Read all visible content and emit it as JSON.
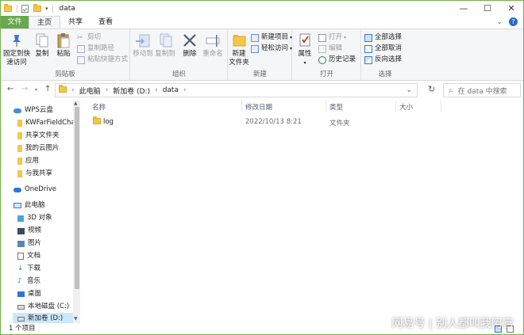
{
  "window": {
    "title": "data"
  },
  "controls": {
    "minimize": "—",
    "maximize": "☐",
    "close": "✕"
  },
  "tabs": [
    {
      "label": "文件"
    },
    {
      "label": "主页"
    },
    {
      "label": "共享"
    },
    {
      "label": "查看"
    }
  ],
  "ribbon": {
    "clipboard": {
      "pin": "固定到快\n速访问",
      "copy": "复制",
      "paste": "粘贴",
      "cut": "剪切",
      "copy_path": "复制路径",
      "paste_shortcut": "粘贴快捷方式",
      "label": "剪贴板"
    },
    "organize": {
      "move_to": "移动到",
      "copy_to": "复制到",
      "delete": "删除",
      "rename": "重命名",
      "label": "组织"
    },
    "new": {
      "new_folder": "新建\n文件夹",
      "new_item": "新建项目",
      "easy_access": "轻松访问",
      "label": "新建"
    },
    "open": {
      "properties": "属性",
      "open": "打开",
      "edit": "编辑",
      "history": "历史记录",
      "label": "打开"
    },
    "select": {
      "select_all": "全部选择",
      "select_none": "全部取消",
      "invert": "反向选择",
      "label": "选择"
    }
  },
  "address": {
    "crumbs": [
      "此电脑",
      "新加卷 (D:)",
      "data"
    ],
    "search_placeholder": "在 data 中搜索"
  },
  "nav": {
    "items": [
      {
        "label": "WPS云盘"
      },
      {
        "label": "KWFarFieldCha"
      },
      {
        "label": "共享文件夹"
      },
      {
        "label": "我的云图片"
      },
      {
        "label": "应用"
      },
      {
        "label": "与我共享"
      },
      {
        "label": "OneDrive"
      },
      {
        "label": "此电脑"
      },
      {
        "label": "3D 对象"
      },
      {
        "label": "视频"
      },
      {
        "label": "图片"
      },
      {
        "label": "文档"
      },
      {
        "label": "下载"
      },
      {
        "label": "音乐"
      },
      {
        "label": "桌面"
      },
      {
        "label": "本地磁盘 (C:)"
      },
      {
        "label": "新加卷 (D:)"
      }
    ]
  },
  "columns": {
    "name": "名称",
    "modified": "修改日期",
    "type": "类型",
    "size": "大小"
  },
  "files": [
    {
      "name": "log",
      "modified": "2022/10/13 8:21",
      "type": "文件夹",
      "size": ""
    }
  ],
  "status": {
    "count": "1 个项目"
  },
  "watermark": {
    "text": "网易号 | 别人都叫我阿宫"
  }
}
